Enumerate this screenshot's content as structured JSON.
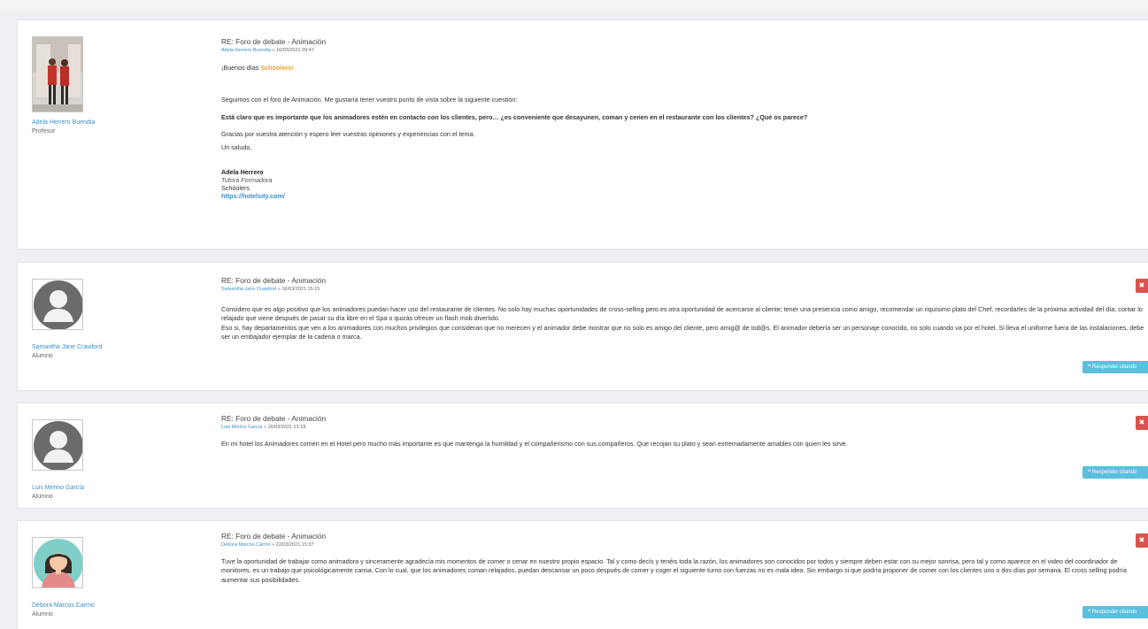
{
  "posts": [
    {
      "subject": "RE: Foro de debate - Animación",
      "author": "Adela Herrero Buendia",
      "date": "16/03/2021 09:47",
      "role": "Profesor",
      "greeting_prefix": "¡Buenos días ",
      "greeting_name": "Schóolers!",
      "para1": "Seguimos con el foro de Animación. Me gustaría tener vuestro punto de vista sobre la siguiente cuestión:",
      "para2": "Está claro que es importante que los animadores estén en contacto con los clientes, pero… ¿es conveniente que desayunen, coman y cenen en el restaurante con los clientes? ¿Qué os parece?",
      "para3": "Gracias por vuestra atención y espero leer vuestras opiniones y experiencias con el tema.",
      "para4": "Un saludo,",
      "sig_name": "Adela Herrero",
      "sig_role": "Tutora Formadora",
      "sig_org": "Schóolers",
      "sig_link": "https://hotelsity.com/"
    },
    {
      "subject": "RE: Foro de debate - Animación",
      "author": "Samantha Jane Crawford",
      "date": "16/03/2021 15:15",
      "role": "Alumno",
      "text1": "Considero que es algo positivo que los animadores puedan hacer uso del restaurante de clientes. No solo hay muchas oportunidades de cross-selling pero es otra oportunidad de acercarse al cliente; tener una presencia como amigo, recomendar un riquísimo plato del Chef, recordarles de la próxima actividad del día, contar lo relajado que viene después de pasar su día libre en el Spa o quizás ofrecer un flash mob divertido.",
      "text2": "Eso si, hay departamentos que ven a los animadores con muchos privilegios que consideran que no merecen y el animador debe mostrar que no solo es amigo del cliente, pero amig@ de tod@s. El animador debería ser un personaje conocido, no solo cuando va por el hotel. Si lleva el uniforme fuera de las instalaciones, debe ser un embajador ejemplar de la cadena o marca.",
      "reply_label": "❝ Responder citando"
    },
    {
      "subject": "RE: Foro de debate - Animación",
      "author": "Luis Merino García",
      "date": "16/03/2021 21:18",
      "role": "Alumno",
      "text1": "En mi hotel los Animadores comen en el Hotel pero mucho más importante es que mantenga la humildad y el compañerismo con sus compañeros. Que recojan su plato y sean extremadamente amables con quien les sirve.",
      "reply_label": "❝ Responder citando"
    },
    {
      "subject": "RE: Foro de debate - Animación",
      "author": "Debora Marcos Carmo",
      "date": "22/03/2021 15:07",
      "role": "Alumno",
      "text1": "Tuve la oportunidad de trabajar como animadora y sinceramente agradecía mis momentos de comer o cenar en nuestro propio espacio. Tal y como decís y tenéis toda la razón, los animadores son conocidos por todos y siempre deben estar con su mejor sonrisa, pero tal y como aparece en el video del coordinador de monitores, es un trabajo que psicológicamente cansa. Con lo cual, que los animadores coman relajados, puedan descansar un poco después de comer y coger el siguiente turno con fuerzas no es mala idea. Sin embargo si que podría proponer de comer con los clientes uno o dos días por semana. El cross selling podría aumentar sus posibilidades.",
      "reply_label": "❝ Responder citando"
    }
  ],
  "colors": {
    "link": "#3b8fc9",
    "greeting": "#f0a030",
    "delete": "#d9534f",
    "reply": "#5bc0de",
    "background": "#eef0f3"
  },
  "icons": {
    "delete": "close-icon",
    "reply": "quote-icon"
  }
}
